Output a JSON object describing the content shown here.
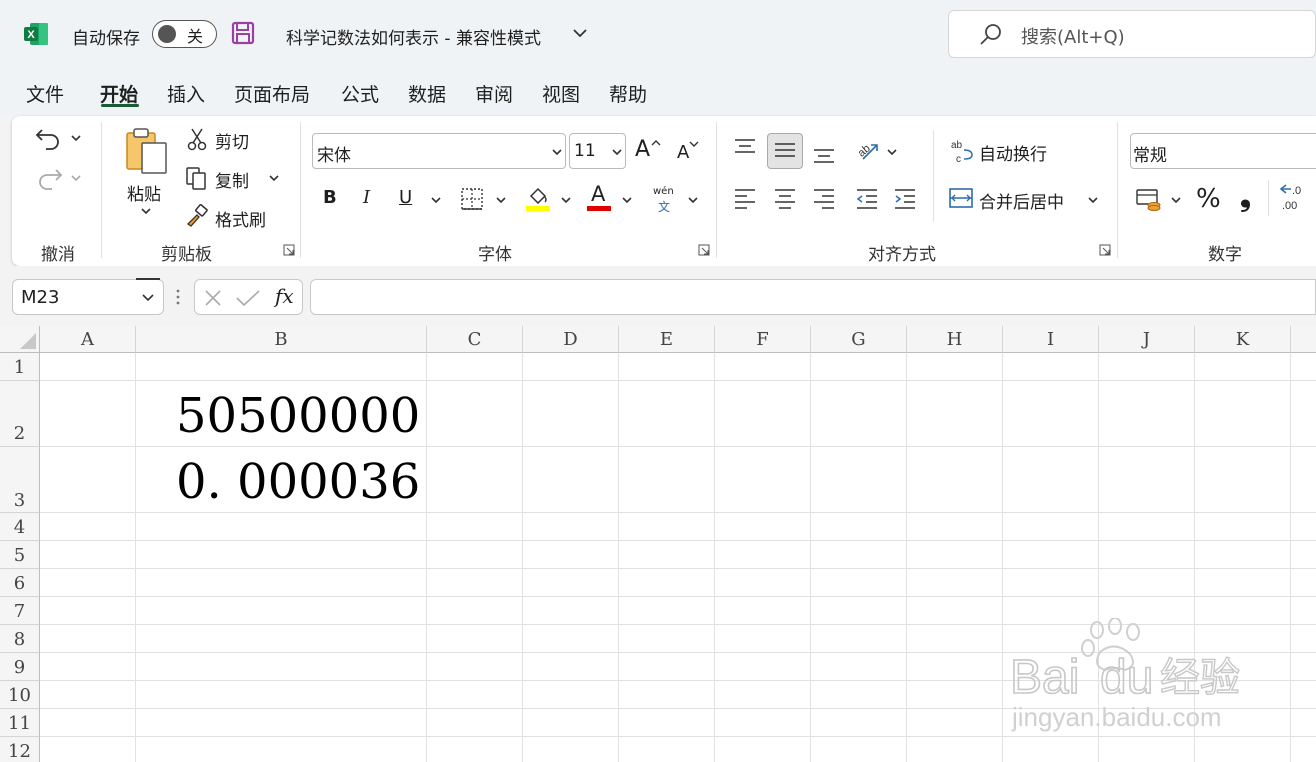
{
  "titlebar": {
    "autosave_label": "自动保存",
    "autosave_state": "关",
    "doc_title": "科学记数法如何表示  -  兼容性模式",
    "search_placeholder": "搜索(Alt+Q)"
  },
  "menu": [
    "文件",
    "开始",
    "插入",
    "页面布局",
    "公式",
    "数据",
    "审阅",
    "视图",
    "帮助"
  ],
  "ribbon": {
    "groups": [
      "撤消",
      "剪贴板",
      "字体",
      "对齐方式",
      "数字"
    ],
    "paste": "粘贴",
    "cut": "剪切",
    "copy": "复制",
    "format_painter": "格式刷",
    "font_name": "宋体",
    "font_size": "11",
    "bold": "B",
    "italic": "I",
    "underline": "U",
    "font_color_letter": "A",
    "grow_font": "A",
    "shrink_font": "A",
    "phonetic_top": "wén",
    "phonetic_bottom": "文",
    "wrap_text": "自动换行",
    "merge_center": "合并后居中",
    "number_format": "常规",
    "percent": "%",
    "comma": "❟",
    "dec_increase_top": ".0",
    "dec_increase_bottom": ".00"
  },
  "formula_bar": {
    "name_box": "M23",
    "fx": "fx",
    "formula": ""
  },
  "sheet": {
    "columns": [
      "A",
      "B",
      "C",
      "D",
      "E",
      "F",
      "G",
      "H",
      "I",
      "J",
      "K"
    ],
    "rows": [
      "1",
      "2",
      "3",
      "4",
      "5",
      "6",
      "7",
      "8",
      "9",
      "10",
      "11",
      "12"
    ],
    "cells": {
      "B2": "50500000",
      "B3": "0. 000036"
    }
  },
  "watermark": {
    "brand": "Bai du 经验",
    "url": "jingyan.baidu.com"
  },
  "colors": {
    "excel_green": "#185c37",
    "save_purple": "#9b3fa5",
    "highlight_yellow": "#ffff00",
    "font_red": "#e00000",
    "icon_blue": "#2b6cb0"
  }
}
